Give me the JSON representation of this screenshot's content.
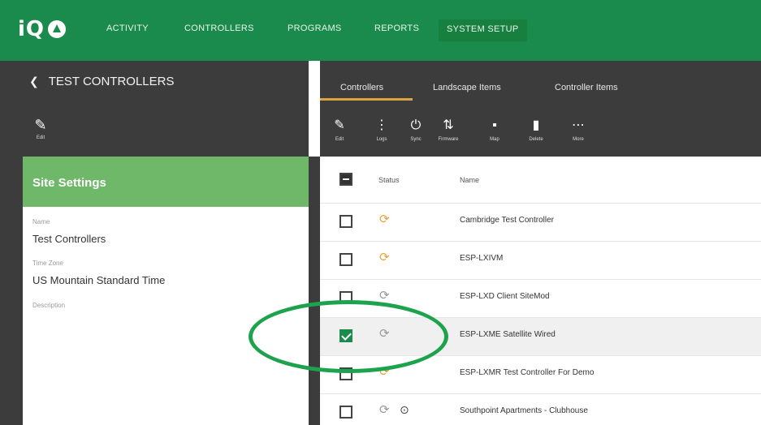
{
  "app": {
    "logo_text": "iQ",
    "nav": [
      {
        "label": "ACTIVITY"
      },
      {
        "label": "CONTROLLERS"
      },
      {
        "label": "PROGRAMS"
      },
      {
        "label": "REPORTS"
      },
      {
        "label": "SYSTEM SETUP",
        "active": true
      }
    ]
  },
  "left": {
    "back_label": "TEST CONTROLLERS",
    "edit_label": "Edit",
    "section_title": "Site Settings",
    "fields": [
      {
        "label": "Name",
        "value": "Test Controllers"
      },
      {
        "label": "Time Zone",
        "value": "US Mountain Standard Time"
      },
      {
        "label": "Description",
        "value": ""
      }
    ]
  },
  "right": {
    "tabs": [
      {
        "label": "Controllers",
        "active": true
      },
      {
        "label": "Landscape Items"
      },
      {
        "label": "Controller Items"
      }
    ],
    "toolbar": [
      {
        "icon": "pencil-icon",
        "glyph": "✎",
        "label": "Edit"
      },
      {
        "icon": "logs-icon",
        "glyph": "⋮",
        "label": "Logs"
      },
      {
        "icon": "sync-icon",
        "glyph": "⏻",
        "label": "Sync"
      },
      {
        "icon": "firmware-icon",
        "glyph": "⇅",
        "label": "Firmware"
      },
      {
        "icon": "map-icon",
        "glyph": "▪",
        "label": "Map"
      },
      {
        "icon": "delete-icon",
        "glyph": "▮",
        "label": "Delete"
      },
      {
        "icon": "more-icon",
        "glyph": "⋯",
        "label": "More"
      }
    ],
    "columns": {
      "status": "Status",
      "name": "Name"
    },
    "rows": [
      {
        "name": "Cambridge Test Controller",
        "status": "orange",
        "glyph": "⟳",
        "checked": false
      },
      {
        "name": "ESP-LXIVM",
        "status": "orange",
        "glyph": "⟳",
        "checked": false
      },
      {
        "name": "ESP-LXD Client SiteMod",
        "status": "gray",
        "glyph": "⟳",
        "checked": false
      },
      {
        "name": "ESP-LXME Satellite Wired",
        "status": "gray",
        "glyph": "⟳",
        "checked": true,
        "selected": true
      },
      {
        "name": "ESP-LXMR Test Controller For Demo",
        "status": "orange",
        "glyph": "⟳",
        "checked": false
      },
      {
        "name": "Southpoint Apartments - Clubhouse",
        "status": "gray",
        "glyph": "⟳",
        "second_glyph": "⊙",
        "checked": false
      }
    ]
  },
  "colors": {
    "brand_green": "#1a8a4d",
    "site_settings_green": "#6fb86a",
    "dark_panel": "#3c3c3c",
    "tab_underline": "#d9a441",
    "status_orange": "#e8a33a",
    "callout_green": "#1da24d"
  }
}
